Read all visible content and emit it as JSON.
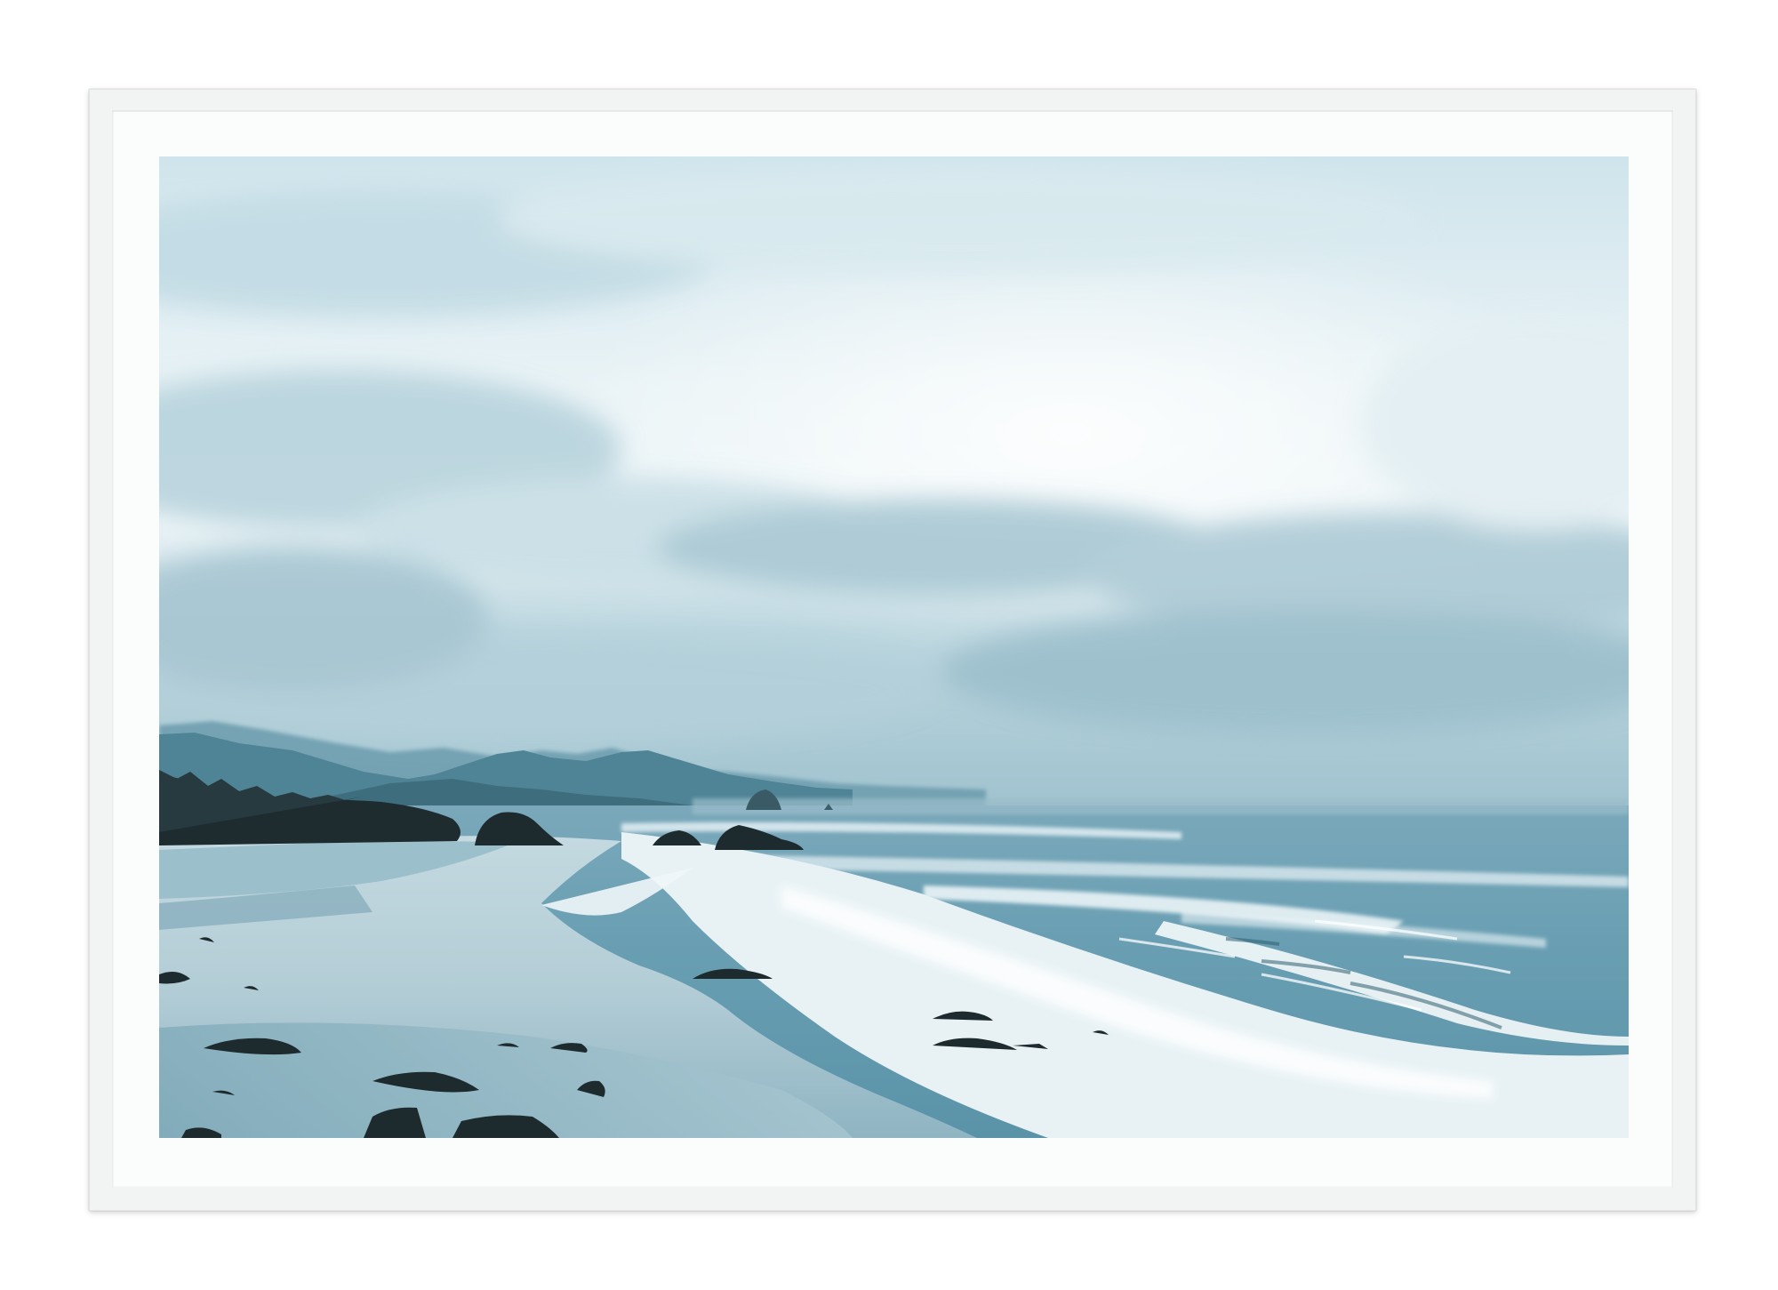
{
  "artwork": {
    "subject": "coastal-seascape-photograph",
    "palette": {
      "sky_light": "#f3f9fb",
      "sky_mid": "#cfe3ea",
      "sky_dark": "#8fb6c4",
      "mountain": "#4f8698",
      "ocean": "#5d93a8",
      "surf": "#eef6f8",
      "sand": "#aecbd5",
      "rock": "#1c2a2e"
    }
  },
  "frame": {
    "color": "#f2f3f3",
    "mat_color": "#fbfcfc"
  }
}
